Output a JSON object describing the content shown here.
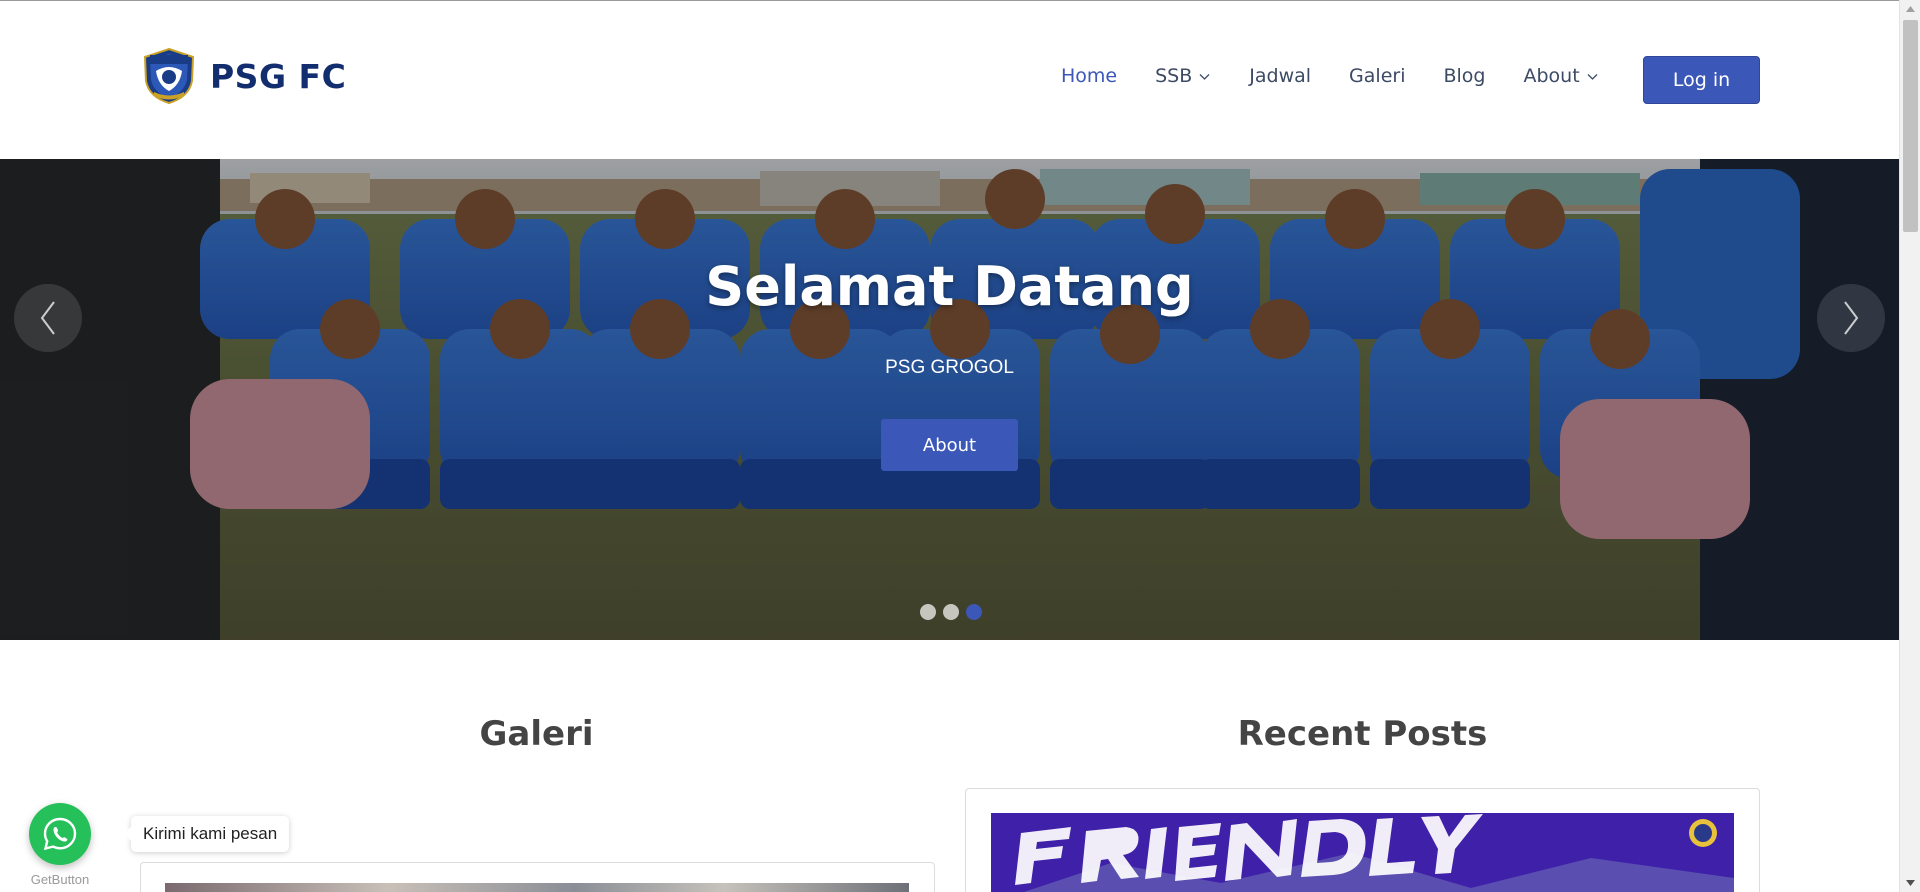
{
  "brand": {
    "name": "PSG FC",
    "logo_icon": "psg-fc-crest",
    "color": "#132e6e"
  },
  "nav": {
    "items": [
      {
        "label": "Home",
        "active": true,
        "dropdown": false
      },
      {
        "label": "SSB",
        "active": false,
        "dropdown": true
      },
      {
        "label": "Jadwal",
        "active": false,
        "dropdown": false
      },
      {
        "label": "Galeri",
        "active": false,
        "dropdown": false
      },
      {
        "label": "Blog",
        "active": false,
        "dropdown": false
      },
      {
        "label": "About",
        "active": false,
        "dropdown": true
      }
    ],
    "login_label": "Log in"
  },
  "hero": {
    "title": "Selamat Datang",
    "subtitle": "PSG GROGOL",
    "button_label": "About",
    "prev_icon": "chevron-left-icon",
    "next_icon": "chevron-right-icon",
    "slides": 3,
    "active_slide": 3
  },
  "sections": {
    "galeri_title": "Galeri",
    "posts_title": "Recent Posts"
  },
  "whatsapp": {
    "icon": "whatsapp-icon",
    "bubble_text": "Kirimi kami pesan",
    "provider_label": "GetButton"
  },
  "colors": {
    "accent": "#3b57b8",
    "whatsapp": "#25c05a"
  }
}
